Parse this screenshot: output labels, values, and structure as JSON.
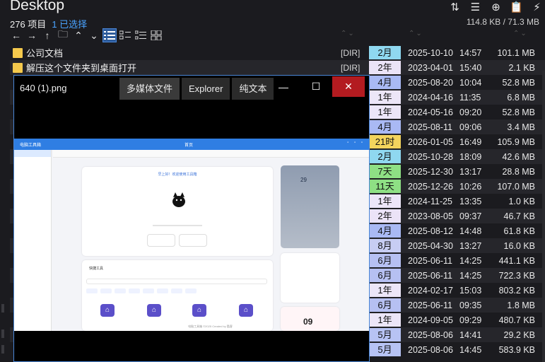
{
  "header": {
    "title": "Desktop",
    "item_count": "276 项目",
    "selected": "1 已选择",
    "size_info": "114.8 KB / 71.3 MB"
  },
  "top_icons": [
    "sort-icon",
    "list-detail-icon",
    "add-circle-icon",
    "clipboard-icon",
    "lightning-icon"
  ],
  "toolbar": [
    "back-arrow-icon",
    "forward-arrow-icon",
    "up-arrow-icon",
    "folder-new-icon",
    "chevron-up-icon",
    "list-view-icon",
    "tree-view-icon",
    "detail-view-icon",
    "grid-view-icon"
  ],
  "files": [
    {
      "name": "公司文档",
      "type": "[DIR]",
      "age": "2月",
      "age_color": "#8fd8f0",
      "date": "2025-10-10",
      "time": "14:57",
      "size": "101.1 MB",
      "folder": true
    },
    {
      "name": "解压这个文件夹到桌面打开",
      "type": "[DIR]",
      "age": "2年",
      "age_color": "#ebe3f7",
      "date": "2023-04-01",
      "time": "15:40",
      "size": "2.1 KB",
      "folder": true
    },
    {
      "name": "",
      "type": "",
      "age": "4月",
      "age_color": "#a9b9f4",
      "date": "2025-08-20",
      "time": "10:04",
      "size": "52.8 MB",
      "folder": false
    },
    {
      "name": "",
      "type": "",
      "age": "1年",
      "age_color": "#ece6f8",
      "date": "2024-04-16",
      "time": "11:35",
      "size": "6.8 MB",
      "folder": false
    },
    {
      "name": "",
      "type": "",
      "age": "1年",
      "age_color": "#ece6f8",
      "date": "2024-05-16",
      "time": "09:20",
      "size": "52.8 MB",
      "folder": false
    },
    {
      "name": "",
      "type": "",
      "age": "4月",
      "age_color": "#a9b9f4",
      "date": "2025-08-11",
      "time": "09:06",
      "size": "3.4 MB",
      "folder": false
    },
    {
      "name": "",
      "type": "",
      "age": "21时",
      "age_color": "#f3d45d",
      "date": "2026-01-05",
      "time": "16:49",
      "size": "105.9 MB",
      "folder": false
    },
    {
      "name": "",
      "type": "",
      "age": "2月",
      "age_color": "#8fd8f0",
      "date": "2025-10-28",
      "time": "18:09",
      "size": "42.6 MB",
      "folder": false
    },
    {
      "name": "",
      "type": "",
      "age": "7天",
      "age_color": "#8ee084",
      "date": "2025-12-30",
      "time": "13:17",
      "size": "28.8 MB",
      "folder": false
    },
    {
      "name": "",
      "type": "",
      "age": "11天",
      "age_color": "#8ee084",
      "date": "2025-12-26",
      "time": "10:26",
      "size": "107.0 MB",
      "folder": false
    },
    {
      "name": "",
      "type": "",
      "age": "1年",
      "age_color": "#ece6f8",
      "date": "2024-11-25",
      "time": "13:35",
      "size": "1.0 KB",
      "folder": false
    },
    {
      "name": "",
      "type": "",
      "age": "2年",
      "age_color": "#ebe3f7",
      "date": "2023-08-05",
      "time": "09:37",
      "size": "46.7 KB",
      "folder": false
    },
    {
      "name": "",
      "type": "",
      "age": "4月",
      "age_color": "#a9b9f4",
      "date": "2025-08-12",
      "time": "14:48",
      "size": "61.8 KB",
      "folder": false
    },
    {
      "name": "",
      "type": "",
      "age": "8月",
      "age_color": "#c7cdf3",
      "date": "2025-04-30",
      "time": "13:27",
      "size": "16.0 KB",
      "folder": false
    },
    {
      "name": "",
      "type": "",
      "age": "6月",
      "age_color": "#b6c0f2",
      "date": "2025-06-11",
      "time": "14:25",
      "size": "441.1 KB",
      "folder": false
    },
    {
      "name": "",
      "type": "",
      "age": "6月",
      "age_color": "#b6c0f2",
      "date": "2025-06-11",
      "time": "14:25",
      "size": "722.3 KB",
      "folder": false
    },
    {
      "name": "",
      "type": "",
      "age": "1年",
      "age_color": "#ece6f8",
      "date": "2024-02-17",
      "time": "15:03",
      "size": "803.2 KB",
      "folder": false
    },
    {
      "name": "",
      "type": "",
      "age": "6月",
      "age_color": "#b6c0f2",
      "date": "2025-06-11",
      "time": "09:35",
      "size": "1.8 MB",
      "folder": false
    },
    {
      "name": "",
      "type": "",
      "age": "1年",
      "age_color": "#ece6f8",
      "date": "2024-09-05",
      "time": "09:29",
      "size": "480.7 KB",
      "folder": false
    },
    {
      "name": "",
      "type": "",
      "age": "5月",
      "age_color": "#b7c3f4",
      "date": "2025-08-06",
      "time": "14:41",
      "size": "29.2 KB",
      "folder": false
    },
    {
      "name": "",
      "type": "",
      "age": "5月",
      "age_color": "#b7c3f4",
      "date": "2025-08-06",
      "time": "14:45",
      "size": "583.9 KB",
      "folder": false
    }
  ],
  "preview": {
    "filename": "640 (1).png",
    "tabs": [
      "多媒体文件",
      "Explorer",
      "纯文本"
    ],
    "active_tab": 0,
    "controls": [
      "minimize-icon",
      "maximize-icon",
      "close-icon"
    ],
    "image": {
      "app_title": "电脑工具箱",
      "window_title": "首页",
      "greeting": "早上好！欢迎使用工具箱",
      "weather_temp": "29",
      "quick_tools_title": "快捷工具",
      "footer": "电脑工具箱 ©2025 Created by 酷客",
      "big_number": "09"
    }
  }
}
